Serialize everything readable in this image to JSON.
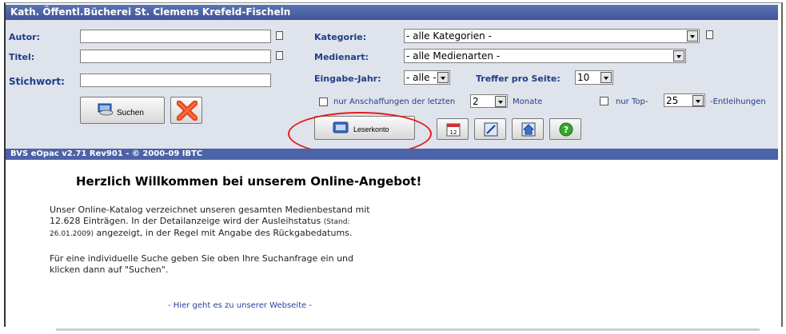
{
  "header": {
    "title": "Kath. Öffentl.Bücherei St. Clemens Krefeld-Fischeln",
    "version": "BVS eOpac v2.71 Rev901 - © 2000-09 IBTC"
  },
  "search": {
    "author_label": "Autor:",
    "title_label": "Titel:",
    "keyword_label": "Stichwort:",
    "category_label": "Kategorie:",
    "category_value": "- alle Kategorien -",
    "media_label": "Medienart:",
    "media_value": "- alle Medienarten -",
    "year_label": "Eingabe-Jahr:",
    "year_value": "- alle -",
    "per_page_label": "Treffer pro Seite:",
    "per_page_value": "10",
    "acq_text": "nur Anschaffungen der letzten",
    "acq_value": "2",
    "months_text": "Monate",
    "top_text": "nur Top-",
    "top_value": "25",
    "loans_text": "-Entleihungen",
    "search_button": "Suchen",
    "account_button": "Leserkonto"
  },
  "main": {
    "welcome": "Herzlich Willkommen bei unserem Online-Angebot!",
    "p1_a": "Unser Online-Katalog verzeichnet unseren gesamten Medienbestand mit",
    "p1_b": "12.628 Einträgen. In der Detailanzeige wird der Ausleihstatus",
    "p1_stand": "(Stand:",
    "p1_date": "26.01.2009)",
    "p1_c": "angezeigt, in der Regel mit Angabe des Rückgabedatums.",
    "p2_a": "Für eine individuelle Suche geben Sie oben Ihre Suchanfrage ein und",
    "p2_b": "klicken dann auf \"Suchen\".",
    "link": "- Hier geht es zu unserer Webseite -"
  },
  "colors": {
    "header_blue": "#3f5599",
    "label_blue": "#203d86",
    "highlight_red": "#e31c1c"
  }
}
